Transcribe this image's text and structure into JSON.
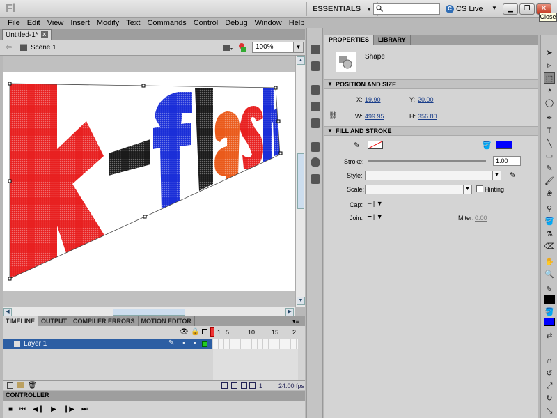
{
  "app": {
    "logo": "Fl",
    "workspace": "ESSENTIALS",
    "cslive": "CS Live",
    "close_tooltip": "Close"
  },
  "menu": [
    "File",
    "Edit",
    "View",
    "Insert",
    "Modify",
    "Text",
    "Commands",
    "Control",
    "Debug",
    "Window",
    "Help"
  ],
  "document": {
    "tab": "Untitled-1*",
    "scene": "Scene 1",
    "zoom": "100%"
  },
  "stage_art": {
    "letters": [
      "k",
      "-",
      "f",
      "l",
      "a",
      "s",
      "h"
    ]
  },
  "timeline": {
    "tabs": [
      "TIMELINE",
      "OUTPUT",
      "COMPILER ERRORS",
      "MOTION EDITOR"
    ],
    "frame_marks": [
      "1",
      "5",
      "10",
      "15",
      "2"
    ],
    "layer": "Layer 1",
    "current_frame": "1",
    "fps": "24.00 fps"
  },
  "controller": {
    "label": "CONTROLLER"
  },
  "properties": {
    "tabs": [
      "PROPERTIES",
      "LIBRARY"
    ],
    "object_type": "Shape",
    "pos_section": "POSITION AND SIZE",
    "x_label": "X:",
    "x": "19.90",
    "y_label": "Y:",
    "y": "20.00",
    "w_label": "W:",
    "w": "499.95",
    "h_label": "H:",
    "h": "356.80",
    "fill_section": "FILL AND STROKE",
    "fill_color": "#0000ff",
    "stroke_label": "Stroke:",
    "stroke": "1.00",
    "style_label": "Style:",
    "scale_label": "Scale:",
    "hinting_label": "Hinting",
    "cap_label": "Cap:",
    "join_label": "Join:",
    "miter_label": "Miter:",
    "miter": "0.00"
  }
}
